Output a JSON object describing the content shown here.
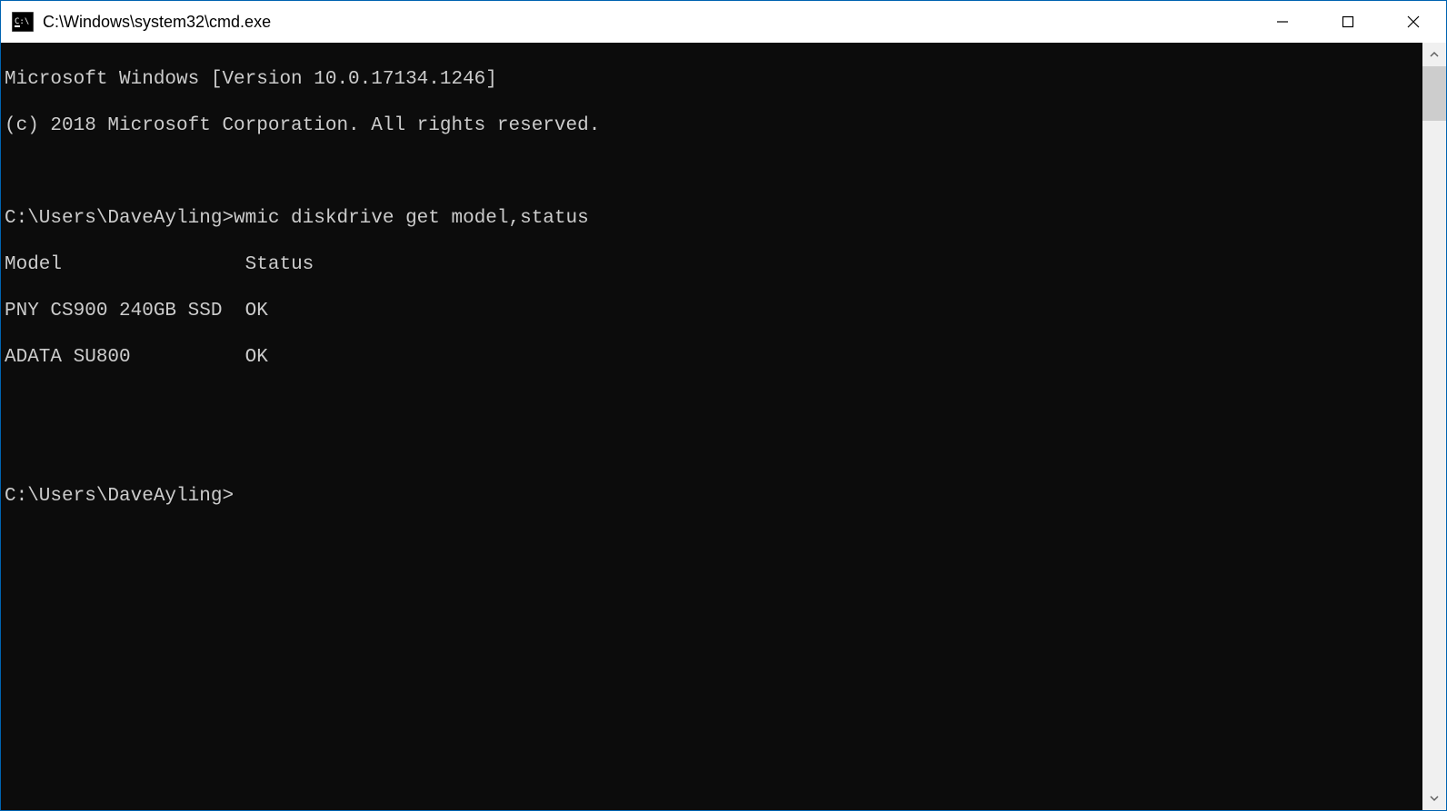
{
  "titlebar": {
    "title": "C:\\Windows\\system32\\cmd.exe"
  },
  "terminal": {
    "banner_line1": "Microsoft Windows [Version 10.0.17134.1246]",
    "banner_line2": "(c) 2018 Microsoft Corporation. All rights reserved.",
    "prompt1_path": "C:\\Users\\DaveAyling>",
    "prompt1_cmd": "wmic diskdrive get model,status",
    "table": {
      "header_model": "Model",
      "header_status": "Status",
      "rows": [
        {
          "model": "PNY CS900 240GB SSD",
          "status": "OK"
        },
        {
          "model": "ADATA SU800",
          "status": "OK"
        }
      ]
    },
    "prompt2_path": "C:\\Users\\DaveAyling>"
  }
}
